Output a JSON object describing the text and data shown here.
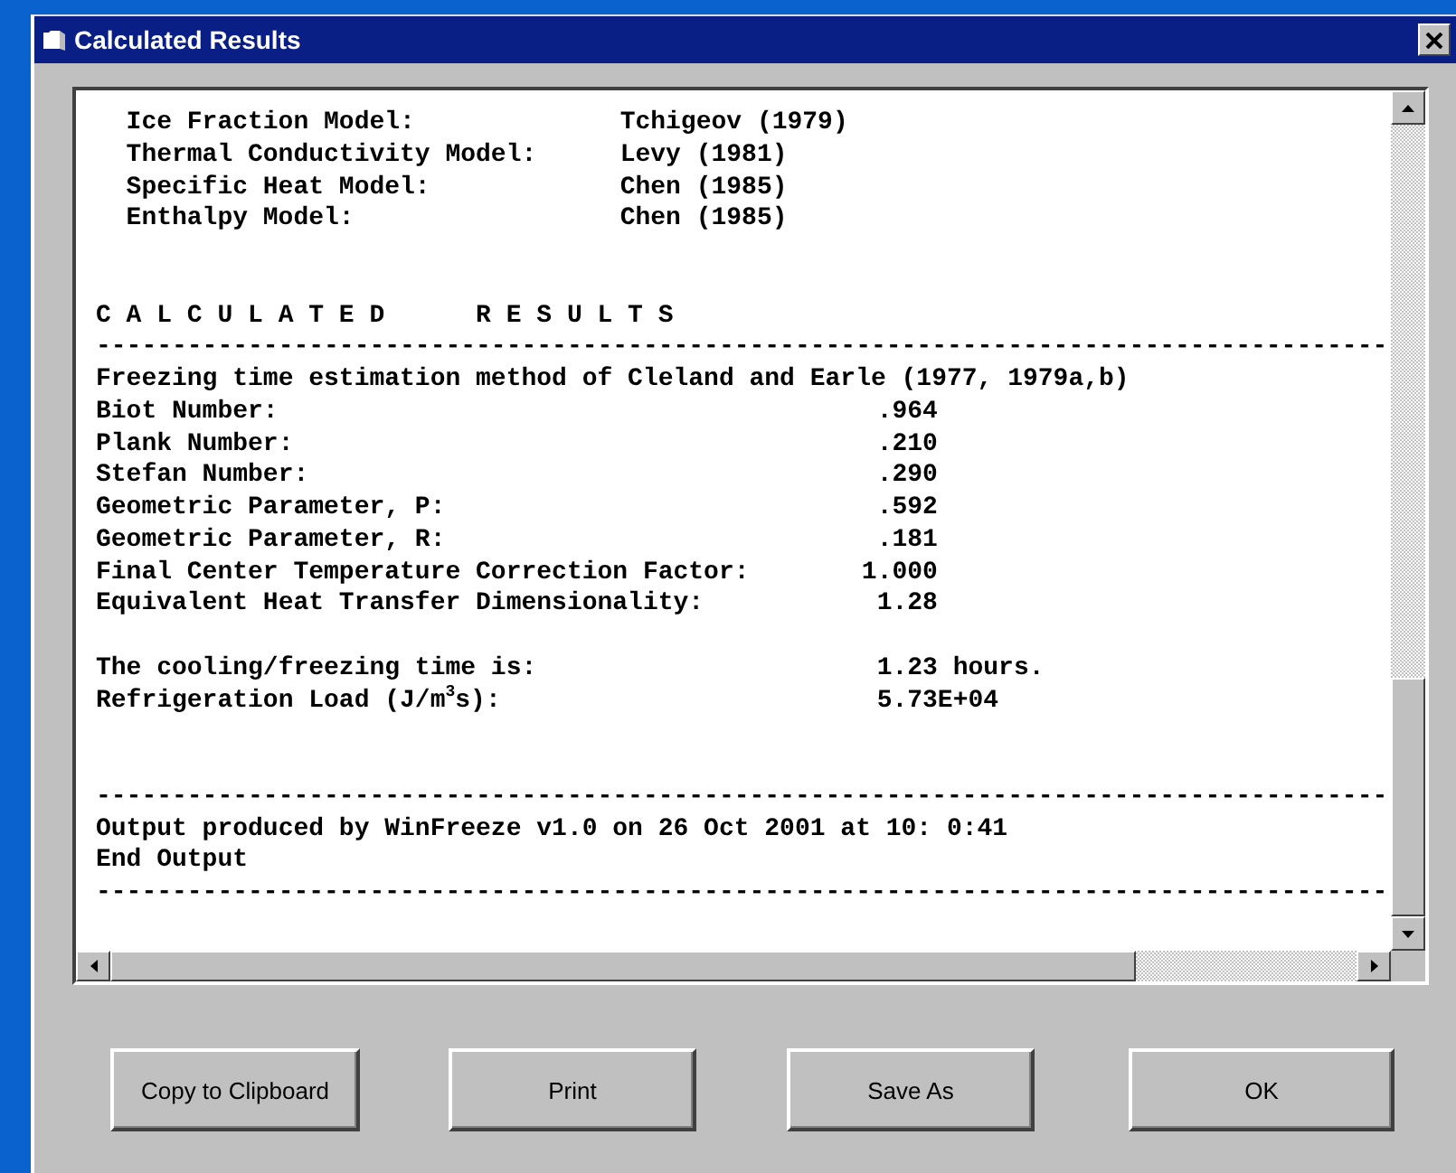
{
  "window": {
    "title": "Calculated Results"
  },
  "output": {
    "lines": [
      {
        "kind": "model",
        "label": "Ice Fraction Model:",
        "value": "Tchigeov (1979)"
      },
      {
        "kind": "model",
        "label": "Thermal Conductivity Model:",
        "value": "Levy (1981)"
      },
      {
        "kind": "model",
        "label": "Specific Heat Model:",
        "value": "Chen (1985)"
      },
      {
        "kind": "model",
        "label": "Enthalpy Model:",
        "value": "Chen (1985)"
      },
      {
        "kind": "blank"
      },
      {
        "kind": "blank"
      },
      {
        "kind": "heading",
        "text": "C A L C U L A T E D      R E S U L T S"
      },
      {
        "kind": "rule",
        "text": "-------------------------------------------------------------------------------------"
      },
      {
        "kind": "text",
        "text": "Freezing time estimation method of Cleland and Earle (1977, 1979a,b)"
      },
      {
        "kind": "result",
        "label": "Biot Number:",
        "value": ".964"
      },
      {
        "kind": "result",
        "label": "Plank Number:",
        "value": ".210"
      },
      {
        "kind": "result",
        "label": "Stefan Number:",
        "value": ".290"
      },
      {
        "kind": "result",
        "label": "Geometric Parameter, P:",
        "value": ".592"
      },
      {
        "kind": "result",
        "label": "Geometric Parameter, R:",
        "value": ".181"
      },
      {
        "kind": "result",
        "label": "Final Center Temperature Correction Factor:",
        "value": "1.000"
      },
      {
        "kind": "result",
        "label": "Equivalent Heat Transfer Dimensionality:",
        "value": "1.28"
      },
      {
        "kind": "blank"
      },
      {
        "kind": "summary",
        "label": "The cooling/freezing time is:",
        "value": "1.23 hours."
      },
      {
        "kind": "summary",
        "label": "Refrigeration Load (J/m$^{3}$s):",
        "value": "5.73E+04"
      },
      {
        "kind": "blank"
      },
      {
        "kind": "blank"
      },
      {
        "kind": "rule",
        "text": "-------------------------------------------------------------------------------------"
      },
      {
        "kind": "text",
        "text": "Output produced by WinFreeze v1.0 on 26 Oct 2001 at 10: 0:41"
      },
      {
        "kind": "text",
        "text": "End Output"
      },
      {
        "kind": "rule",
        "text": "-------------------------------------------------------------------------------------"
      }
    ]
  },
  "buttons": [
    "Copy to Clipboard",
    "Print",
    "Save As",
    "OK"
  ]
}
